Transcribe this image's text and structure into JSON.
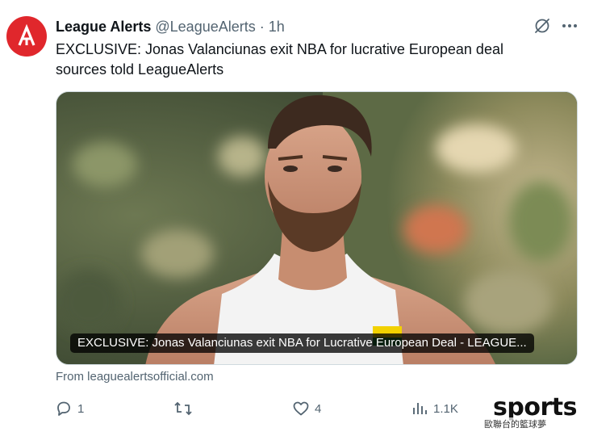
{
  "post": {
    "display_name": "League Alerts",
    "handle": "@LeagueAlerts",
    "separator": "·",
    "time": "1h",
    "text_line1": "EXCLUSIVE: Jonas Valanciunas exit NBA for lucrative European deal",
    "text_line2": "sources told LeagueAlerts",
    "avatar_icon": "league-alerts-logo",
    "brand_color": "#e0272c"
  },
  "card": {
    "caption": "EXCLUSIVE: Jonas Valanciunas exit NBA for Lucrative European Deal - LEAGUE...",
    "source": "From leaguealertsofficial.com",
    "image_description_icon": "basketball-player-photo"
  },
  "actions": {
    "replies": "1",
    "reposts": "",
    "likes": "4",
    "views": "1.1K"
  },
  "watermark": {
    "text": "sports",
    "subtext": "歐聯台的籃球夢"
  }
}
